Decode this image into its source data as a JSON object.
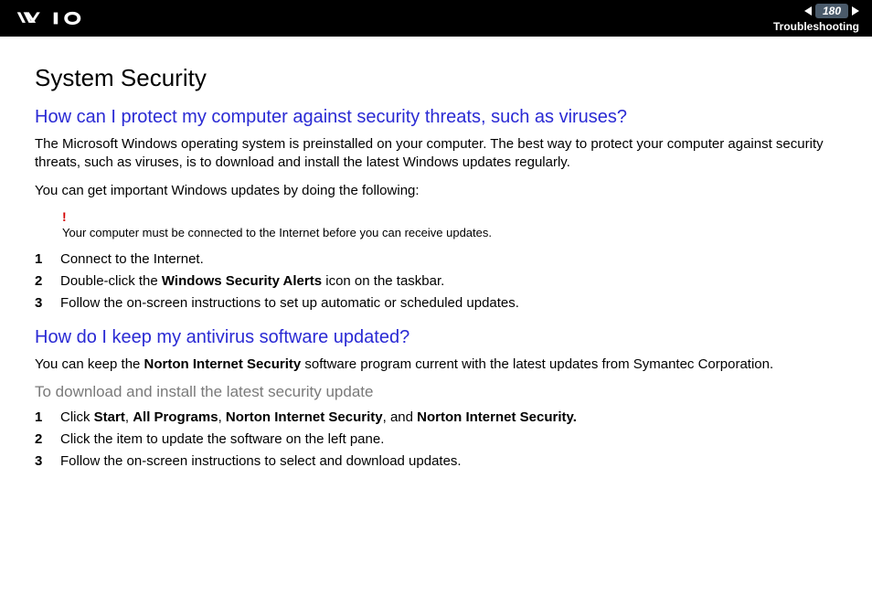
{
  "header": {
    "page_number": "180",
    "section": "Troubleshooting"
  },
  "title": "System Security",
  "q1": {
    "heading": "How can I protect my computer against security threats, such as viruses?",
    "p1": "The Microsoft Windows operating system is preinstalled on your computer. The best way to protect your computer against security threats, such as viruses, is to download and install the latest Windows updates regularly.",
    "p2": "You can get important Windows updates by doing the following:",
    "note": "Your computer must be connected to the Internet before you can receive updates.",
    "steps": {
      "s1": "Connect to the Internet.",
      "s2_pre": "Double-click the ",
      "s2_b": "Windows Security Alerts",
      "s2_post": " icon on the taskbar.",
      "s3": "Follow the on-screen instructions to set up automatic or scheduled updates."
    }
  },
  "q2": {
    "heading": "How do I keep my antivirus software updated?",
    "p1_pre": "You can keep the ",
    "p1_b": "Norton Internet Security",
    "p1_post": " software program current with the latest updates from Symantec Corporation.",
    "subheading": "To download and install the latest security update",
    "steps": {
      "s1_pre": "Click ",
      "s1_b1": "Start",
      "s1_c1": ", ",
      "s1_b2": "All Programs",
      "s1_c2": ", ",
      "s1_b3": "Norton Internet Security",
      "s1_c3": ", and ",
      "s1_b4": "Norton Internet Security.",
      "s2": "Click the item to update the software on the left pane.",
      "s3": "Follow the on-screen instructions to select and download updates."
    }
  },
  "numbers": {
    "n1": "1",
    "n2": "2",
    "n3": "3"
  }
}
